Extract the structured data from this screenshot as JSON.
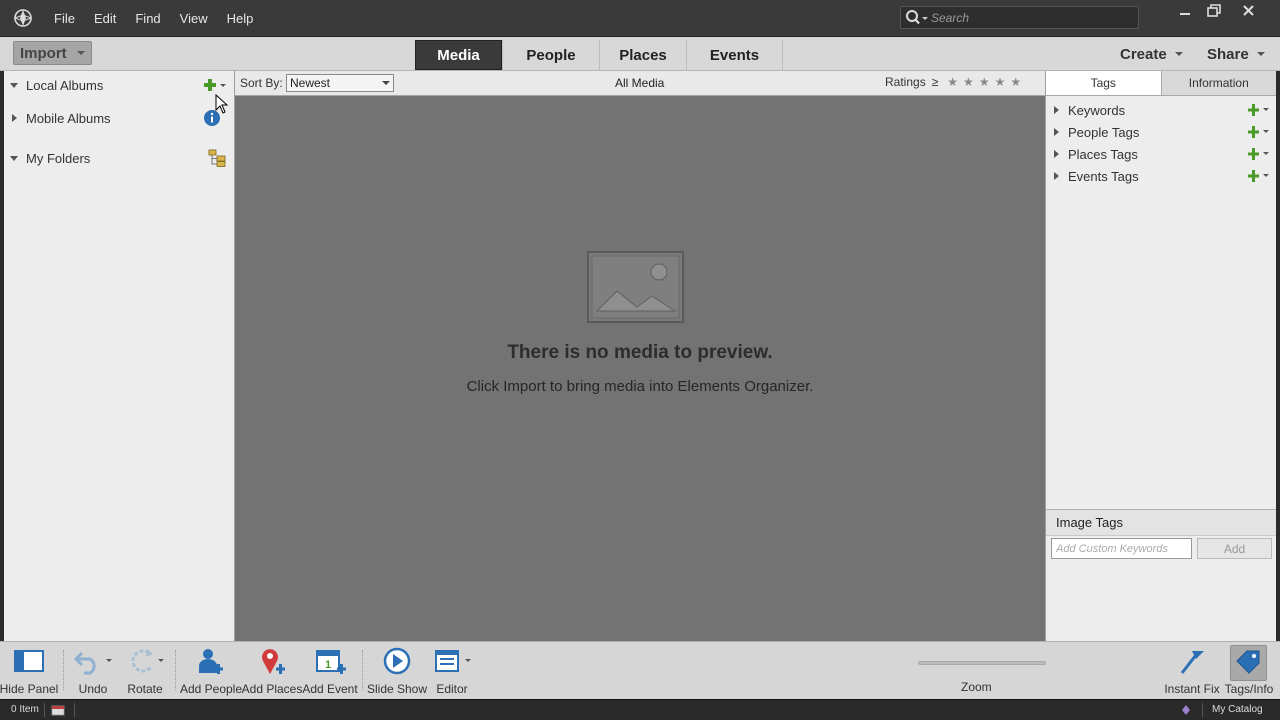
{
  "menu": {
    "items": [
      "File",
      "Edit",
      "Find",
      "View",
      "Help"
    ]
  },
  "search": {
    "placeholder": "Search"
  },
  "toolbar": {
    "import_label": "Import",
    "tabs": [
      "Media",
      "People",
      "Places",
      "Events"
    ],
    "active_tab": "Media",
    "create_label": "Create",
    "share_label": "Share"
  },
  "left_panel": {
    "local_albums": "Local Albums",
    "mobile_albums": "Mobile Albums",
    "my_folders": "My Folders"
  },
  "content_header": {
    "sort_by_label": "Sort By:",
    "sort_value": "Newest",
    "title": "All Media",
    "ratings_label": "Ratings",
    "ratings_operator": "≥",
    "stars": 5
  },
  "content": {
    "empty_title": "There is no media to preview.",
    "empty_subtitle": "Click Import to bring media into Elements Organizer."
  },
  "right_panel": {
    "tabs": [
      "Tags",
      "Information"
    ],
    "active_tab": "Tags",
    "tag_groups": [
      "Keywords",
      "People Tags",
      "Places Tags",
      "Events Tags"
    ],
    "image_tags_header": "Image Tags",
    "custom_keywords_placeholder": "Add Custom Keywords",
    "add_label": "Add"
  },
  "action_bar": {
    "hide_panel": "Hide Panel",
    "undo": "Undo",
    "rotate": "Rotate",
    "add_people": "Add People",
    "add_places": "Add Places",
    "add_event": "Add Event",
    "slide_show": "Slide Show",
    "editor": "Editor",
    "zoom": "Zoom",
    "instant_fix": "Instant Fix",
    "tags_info": "Tags/Info"
  },
  "status_bar": {
    "item_count": "0 Item",
    "catalog": "My Catalog"
  },
  "colors": {
    "accent_blue": "#2b6fb5",
    "add_green": "#4a9a2a",
    "content_bg": "#737373",
    "titlebar_bg": "#3a3a3a"
  }
}
